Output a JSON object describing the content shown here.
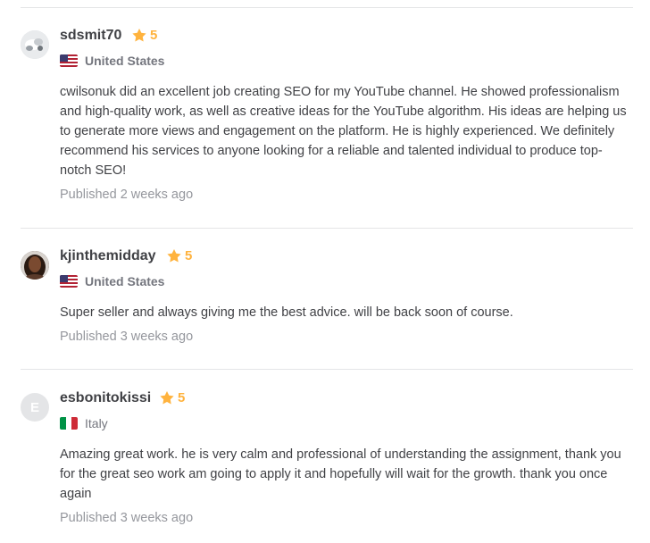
{
  "reviews": [
    {
      "username": "sdsmit70",
      "rating": "5",
      "country": "United States",
      "flag_icon": "us-flag-icon",
      "avatar": "photo",
      "text": "cwilsonuk did an excellent job creating SEO for my YouTube channel. He showed professionalism and high-quality work, as well as creative ideas for the YouTube algorithm. His ideas are helping us to generate more views and engagement on the platform. He is highly experienced. We definitely recommend his services to anyone looking for a reliable and talented individual to produce top-notch SEO!",
      "published": "Published 2 weeks ago"
    },
    {
      "username": "kjinthemidday",
      "rating": "5",
      "country": "United States",
      "flag_icon": "us-flag-icon",
      "avatar": "photo",
      "text": "Super seller and always giving me the best advice. will be back soon of course.",
      "published": "Published 3 weeks ago"
    },
    {
      "username": "esbonitokissi",
      "rating": "5",
      "country": "Italy",
      "flag_icon": "italy-flag-icon",
      "avatar": "E",
      "text": "Amazing great work. he is very calm and professional of understanding the assignment, thank you for the great seo work am going to apply it and hopefully will wait for the growth. thank you once again",
      "published": "Published 3 weeks ago"
    }
  ],
  "colors": {
    "star": "#ffb33e",
    "text": "#404145",
    "muted": "#74767e",
    "published": "#95979d",
    "divider": "#e4e5e7"
  }
}
